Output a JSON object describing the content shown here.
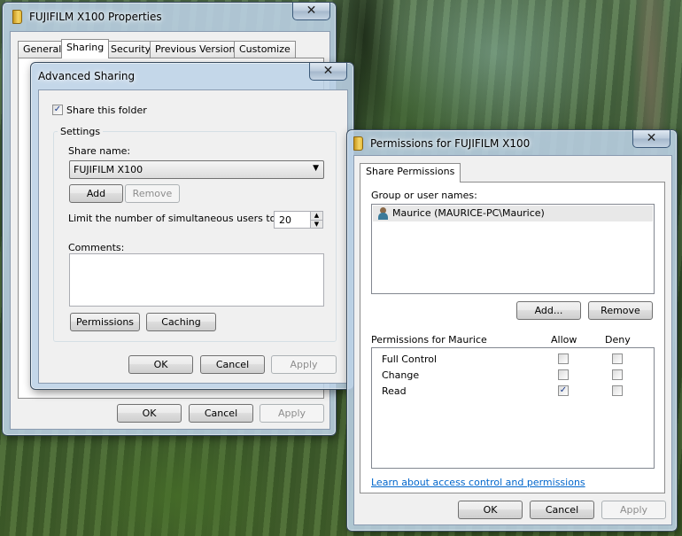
{
  "props_window": {
    "title": "FUJIFILM X100 Properties",
    "tabs": [
      "General",
      "Sharing",
      "Security",
      "Previous Versions",
      "Customize"
    ],
    "ok": "OK",
    "cancel": "Cancel",
    "apply": "Apply",
    "close_glyph": "✕"
  },
  "advanced_sharing": {
    "title": "Advanced Sharing",
    "share_checkbox_label": "Share this folder",
    "share_checked": true,
    "settings_label": "Settings",
    "share_name_label": "Share name:",
    "share_name_value": "FUJIFILM X100",
    "add": "Add",
    "remove": "Remove",
    "limit_label": "Limit the number of simultaneous users to:",
    "limit_value": "20",
    "comments_label": "Comments:",
    "permissions": "Permissions",
    "caching": "Caching",
    "ok": "OK",
    "cancel": "Cancel",
    "apply": "Apply",
    "close_glyph": "✕"
  },
  "permissions_window": {
    "title": "Permissions for FUJIFILM X100",
    "tab": "Share Permissions",
    "group_label": "Group or user names:",
    "users": [
      {
        "name": "Maurice (MAURICE-PC\\Maurice)",
        "icon": "user-icon"
      }
    ],
    "add": "Add...",
    "remove": "Remove",
    "perm_for_label": "Permissions for Maurice",
    "allow_label": "Allow",
    "deny_label": "Deny",
    "rows": [
      {
        "name": "Full Control",
        "allow": false,
        "deny": false
      },
      {
        "name": "Change",
        "allow": false,
        "deny": false
      },
      {
        "name": "Read",
        "allow": true,
        "deny": false
      }
    ],
    "learn_link": "Learn about access control and permissions",
    "ok": "OK",
    "cancel": "Cancel",
    "apply": "Apply",
    "close_glyph": "✕"
  },
  "check_glyph": "✓",
  "dropdown_glyph": "▼",
  "spin_up": "▲",
  "spin_down": "▼"
}
